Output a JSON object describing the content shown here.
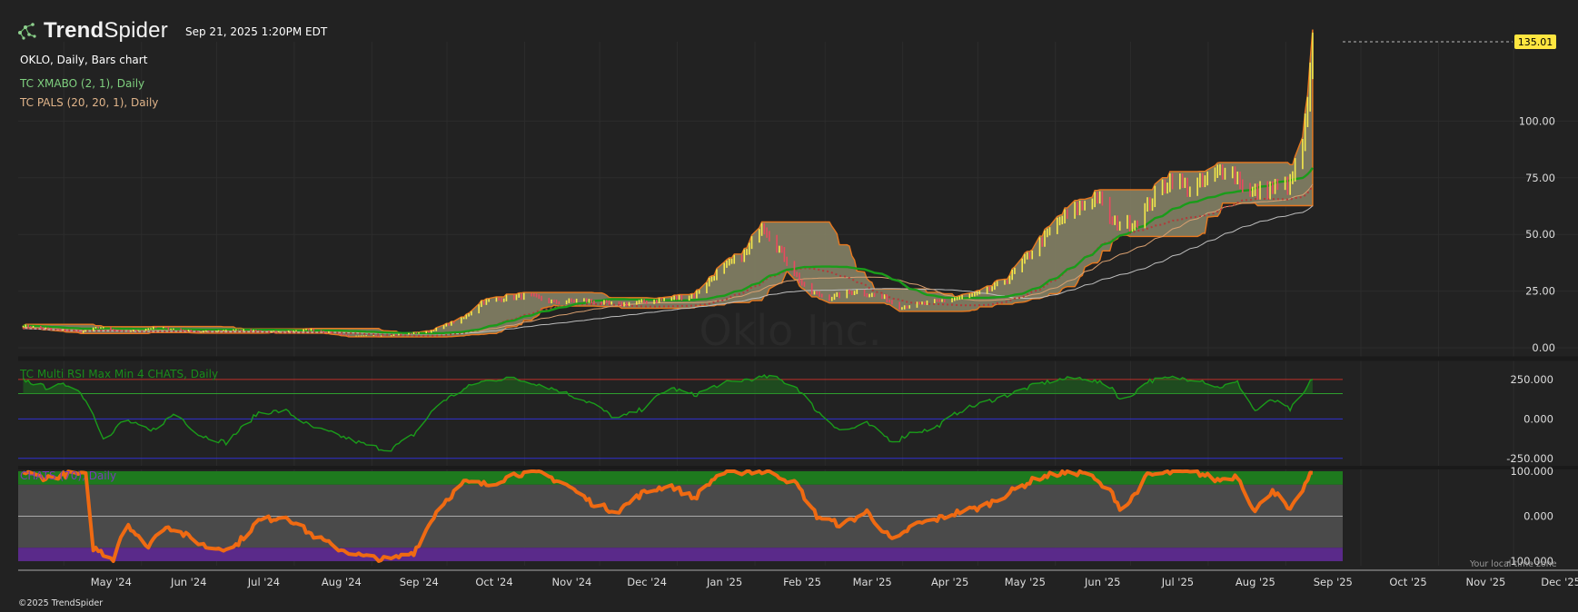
{
  "header": {
    "brand_prefix": "Trend",
    "brand_suffix": "Spider",
    "logo_icon": "network-nodes-icon",
    "timestamp": "Sep 21, 2025 1:20PM EDT"
  },
  "chart_labels": {
    "symbol": "OKLO, Daily, Bars chart",
    "xmabo": "TC XMABO (2, 1), Daily",
    "pals": "TC PALS (20, 20, 1), Daily",
    "rsi": "TC Multi RSI Max Min 4 CHATS, Daily",
    "chats": "CHATS (70), Daily",
    "watermark": "Oklo Inc."
  },
  "footer": {
    "copyright": "©2025 TrendSpider",
    "timezone_note": "Your local time zone"
  },
  "colors": {
    "background": "#222222",
    "grid": "#2c2c2c",
    "bar_up": "#f5e84a",
    "bar_down": "#e84a5f",
    "band_fill": "#8a8668",
    "band_edge": "#e8781e",
    "xmabo": "#1a9c1a",
    "rsi_line": "#1a9c1a",
    "chats_line": "#ef6a12",
    "price_tag": "#ffe640"
  },
  "chart_data": [
    {
      "type": "bar",
      "name_label": "OKLO, Daily, Bars chart",
      "x_ticks": [
        "May '24",
        "Jun '24",
        "Jul '24",
        "Aug '24",
        "Sep '24",
        "Oct '24",
        "Nov '24",
        "Dec '24",
        "Jan '25",
        "Feb '25",
        "Mar '25",
        "Apr '25",
        "May '25",
        "Jun '25",
        "Jul '25",
        "Aug '25",
        "Sep '25",
        "Oct '25",
        "Nov '25",
        "Dec '25"
      ],
      "y_ticks": [
        "0.00",
        "25.00",
        "50.00",
        "75.00",
        "100.00"
      ],
      "y_tick_values": [
        0,
        25,
        50,
        75,
        100
      ],
      "ylim": [
        -2,
        135
      ],
      "last_price": 135.01,
      "last_price_label": "135.01",
      "close_anchors": [
        [
          "2024-04-20",
          10
        ],
        [
          "2024-05-05",
          8
        ],
        [
          "2024-05-15",
          7
        ],
        [
          "2024-05-22",
          9
        ],
        [
          "2024-06-01",
          7
        ],
        [
          "2024-06-15",
          9
        ],
        [
          "2024-07-01",
          7
        ],
        [
          "2024-07-15",
          8
        ],
        [
          "2024-08-01",
          7
        ],
        [
          "2024-08-15",
          8
        ],
        [
          "2024-09-01",
          5
        ],
        [
          "2024-09-15",
          5.5
        ],
        [
          "2024-10-01",
          7
        ],
        [
          "2024-10-15",
          13
        ],
        [
          "2024-10-22",
          20
        ],
        [
          "2024-11-01",
          22
        ],
        [
          "2024-11-10",
          23
        ],
        [
          "2024-11-20",
          20
        ],
        [
          "2024-12-01",
          21
        ],
        [
          "2024-12-15",
          19
        ],
        [
          "2025-01-01",
          21
        ],
        [
          "2025-01-15",
          23
        ],
        [
          "2025-01-25",
          34
        ],
        [
          "2025-02-05",
          42
        ],
        [
          "2025-02-11",
          55
        ],
        [
          "2025-02-20",
          40
        ],
        [
          "2025-03-01",
          25
        ],
        [
          "2025-03-10",
          22
        ],
        [
          "2025-03-20",
          25
        ],
        [
          "2025-04-01",
          22
        ],
        [
          "2025-04-07",
          18
        ],
        [
          "2025-04-20",
          20
        ],
        [
          "2025-05-01",
          22
        ],
        [
          "2025-05-10",
          24
        ],
        [
          "2025-05-20",
          30
        ],
        [
          "2025-06-01",
          45
        ],
        [
          "2025-06-10",
          56
        ],
        [
          "2025-06-15",
          60
        ],
        [
          "2025-06-25",
          67
        ],
        [
          "2025-07-01",
          55
        ],
        [
          "2025-07-10",
          55
        ],
        [
          "2025-07-20",
          70
        ],
        [
          "2025-07-25",
          75
        ],
        [
          "2025-08-01",
          70
        ],
        [
          "2025-08-10",
          75
        ],
        [
          "2025-08-15",
          80
        ],
        [
          "2025-08-20",
          75
        ],
        [
          "2025-08-25",
          68
        ],
        [
          "2025-09-01",
          70
        ],
        [
          "2025-09-10",
          72
        ],
        [
          "2025-09-15",
          90
        ],
        [
          "2025-09-17",
          105
        ],
        [
          "2025-09-19",
          135.01
        ]
      ]
    },
    {
      "type": "line",
      "name_label": "TC Multi RSI Max Min 4 CHATS, Daily",
      "y_ticks": [
        "250.000",
        "0.000",
        "-250.000"
      ],
      "y_tick_values": [
        250,
        0,
        -250
      ],
      "ylim": [
        -280,
        330
      ],
      "reference_levels": [
        {
          "value": 250,
          "color": "#c0302a"
        },
        {
          "value": 160,
          "color": "#2fa02f"
        },
        {
          "value": 0,
          "color": "#3030d0"
        },
        {
          "value": -250,
          "color": "#3030d0"
        }
      ],
      "anchors": [
        [
          "2024-04-20",
          260
        ],
        [
          "2024-05-01",
          200
        ],
        [
          "2024-05-12",
          220
        ],
        [
          "2024-05-18",
          100
        ],
        [
          "2024-05-25",
          -150
        ],
        [
          "2024-06-01",
          0
        ],
        [
          "2024-06-12",
          -80
        ],
        [
          "2024-06-22",
          40
        ],
        [
          "2024-07-01",
          -100
        ],
        [
          "2024-07-12",
          -150
        ],
        [
          "2024-07-25",
          40
        ],
        [
          "2024-08-05",
          50
        ],
        [
          "2024-08-15",
          -50
        ],
        [
          "2024-08-25",
          -100
        ],
        [
          "2024-09-05",
          -160
        ],
        [
          "2024-09-15",
          -200
        ],
        [
          "2024-09-25",
          -100
        ],
        [
          "2024-10-05",
          100
        ],
        [
          "2024-10-20",
          230
        ],
        [
          "2024-11-01",
          260
        ],
        [
          "2024-11-12",
          230
        ],
        [
          "2024-11-22",
          180
        ],
        [
          "2024-12-05",
          100
        ],
        [
          "2024-12-15",
          0
        ],
        [
          "2024-12-25",
          60
        ],
        [
          "2025-01-05",
          200
        ],
        [
          "2025-01-15",
          150
        ],
        [
          "2025-01-25",
          220
        ],
        [
          "2025-02-05",
          250
        ],
        [
          "2025-02-15",
          270
        ],
        [
          "2025-02-25",
          200
        ],
        [
          "2025-03-05",
          50
        ],
        [
          "2025-03-15",
          -80
        ],
        [
          "2025-03-25",
          -30
        ],
        [
          "2025-04-05",
          -150
        ],
        [
          "2025-04-12",
          -80
        ],
        [
          "2025-04-20",
          -70
        ],
        [
          "2025-05-01",
          50
        ],
        [
          "2025-05-10",
          100
        ],
        [
          "2025-05-20",
          150
        ],
        [
          "2025-06-01",
          220
        ],
        [
          "2025-06-10",
          250
        ],
        [
          "2025-06-20",
          260
        ],
        [
          "2025-07-01",
          200
        ],
        [
          "2025-07-05",
          100
        ],
        [
          "2025-07-15",
          240
        ],
        [
          "2025-07-25",
          260
        ],
        [
          "2025-08-05",
          250
        ],
        [
          "2025-08-12",
          200
        ],
        [
          "2025-08-20",
          230
        ],
        [
          "2025-08-27",
          50
        ],
        [
          "2025-09-03",
          120
        ],
        [
          "2025-09-10",
          60
        ],
        [
          "2025-09-15",
          150
        ],
        [
          "2025-09-19",
          260
        ]
      ]
    },
    {
      "type": "line",
      "name_label": "CHATS (70), Daily",
      "y_ticks": [
        "100.000",
        "0.000",
        "-100.000"
      ],
      "y_tick_values": [
        100,
        0,
        -100
      ],
      "ylim": [
        -110,
        110
      ],
      "zones": [
        {
          "from": 70,
          "to": 100,
          "color": "#1e7a1e"
        },
        {
          "from": -70,
          "to": 70,
          "color": "#4a4a4a"
        },
        {
          "from": -100,
          "to": -70,
          "color": "#5a2a8a"
        }
      ],
      "anchors": [
        [
          "2024-04-20",
          100
        ],
        [
          "2024-05-01",
          85
        ],
        [
          "2024-05-12",
          95
        ],
        [
          "2024-05-17",
          90
        ],
        [
          "2024-05-20",
          -70
        ],
        [
          "2024-05-28",
          -95
        ],
        [
          "2024-06-02",
          -10
        ],
        [
          "2024-06-10",
          -70
        ],
        [
          "2024-06-18",
          -20
        ],
        [
          "2024-06-25",
          -40
        ],
        [
          "2024-07-05",
          -70
        ],
        [
          "2024-07-15",
          -70
        ],
        [
          "2024-07-25",
          -10
        ],
        [
          "2024-08-05",
          0
        ],
        [
          "2024-08-15",
          -40
        ],
        [
          "2024-08-25",
          -70
        ],
        [
          "2024-09-05",
          -90
        ],
        [
          "2024-09-15",
          -98
        ],
        [
          "2024-09-25",
          -80
        ],
        [
          "2024-10-05",
          20
        ],
        [
          "2024-10-15",
          75
        ],
        [
          "2024-10-25",
          70
        ],
        [
          "2024-11-05",
          95
        ],
        [
          "2024-11-15",
          95
        ],
        [
          "2024-11-25",
          70
        ],
        [
          "2024-12-05",
          30
        ],
        [
          "2024-12-15",
          10
        ],
        [
          "2024-12-25",
          50
        ],
        [
          "2025-01-05",
          70
        ],
        [
          "2025-01-15",
          40
        ],
        [
          "2025-01-25",
          95
        ],
        [
          "2025-02-05",
          100
        ],
        [
          "2025-02-15",
          98
        ],
        [
          "2025-02-25",
          70
        ],
        [
          "2025-03-05",
          0
        ],
        [
          "2025-03-15",
          -20
        ],
        [
          "2025-03-25",
          10
        ],
        [
          "2025-04-05",
          -60
        ],
        [
          "2025-04-12",
          -20
        ],
        [
          "2025-04-20",
          -10
        ],
        [
          "2025-05-01",
          10
        ],
        [
          "2025-05-10",
          20
        ],
        [
          "2025-05-20",
          50
        ],
        [
          "2025-06-01",
          85
        ],
        [
          "2025-06-10",
          95
        ],
        [
          "2025-06-20",
          98
        ],
        [
          "2025-07-01",
          50
        ],
        [
          "2025-07-05",
          10
        ],
        [
          "2025-07-15",
          90
        ],
        [
          "2025-07-25",
          98
        ],
        [
          "2025-08-05",
          95
        ],
        [
          "2025-08-12",
          80
        ],
        [
          "2025-08-20",
          90
        ],
        [
          "2025-08-27",
          10
        ],
        [
          "2025-09-03",
          60
        ],
        [
          "2025-09-10",
          10
        ],
        [
          "2025-09-15",
          60
        ],
        [
          "2025-09-19",
          100
        ]
      ]
    }
  ]
}
